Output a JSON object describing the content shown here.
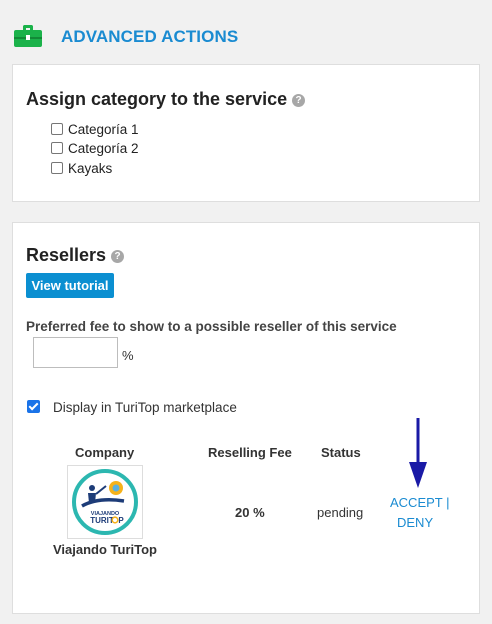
{
  "header": {
    "title": "ADVANCED ACTIONS",
    "icon": "briefcase-icon",
    "accent": "#1a8bd1",
    "icon_color": "#1bb24a"
  },
  "category": {
    "title": "Assign category to the service",
    "options": [
      {
        "label": "Categoría 1",
        "checked": false
      },
      {
        "label": "Categoría 2",
        "checked": false
      },
      {
        "label": "Kayaks",
        "checked": false
      }
    ]
  },
  "resellers": {
    "title": "Resellers",
    "tutorial_button": "View tutorial",
    "fee_label": "Preferred fee to show to a possible reseller of this service",
    "fee_value": "",
    "fee_unit": "%",
    "marketplace_label": "Display in TuriTop marketplace",
    "marketplace_checked": true,
    "table": {
      "headers": [
        "Company",
        "Reselling Fee",
        "Status"
      ],
      "rows": [
        {
          "company": "Viajando TuriTop",
          "logo_text": [
            "VIAJANDO",
            "TURIT",
            "P"
          ],
          "fee": "20 %",
          "status": "pending",
          "accept": "ACCEPT |",
          "deny": "DENY"
        }
      ]
    }
  }
}
